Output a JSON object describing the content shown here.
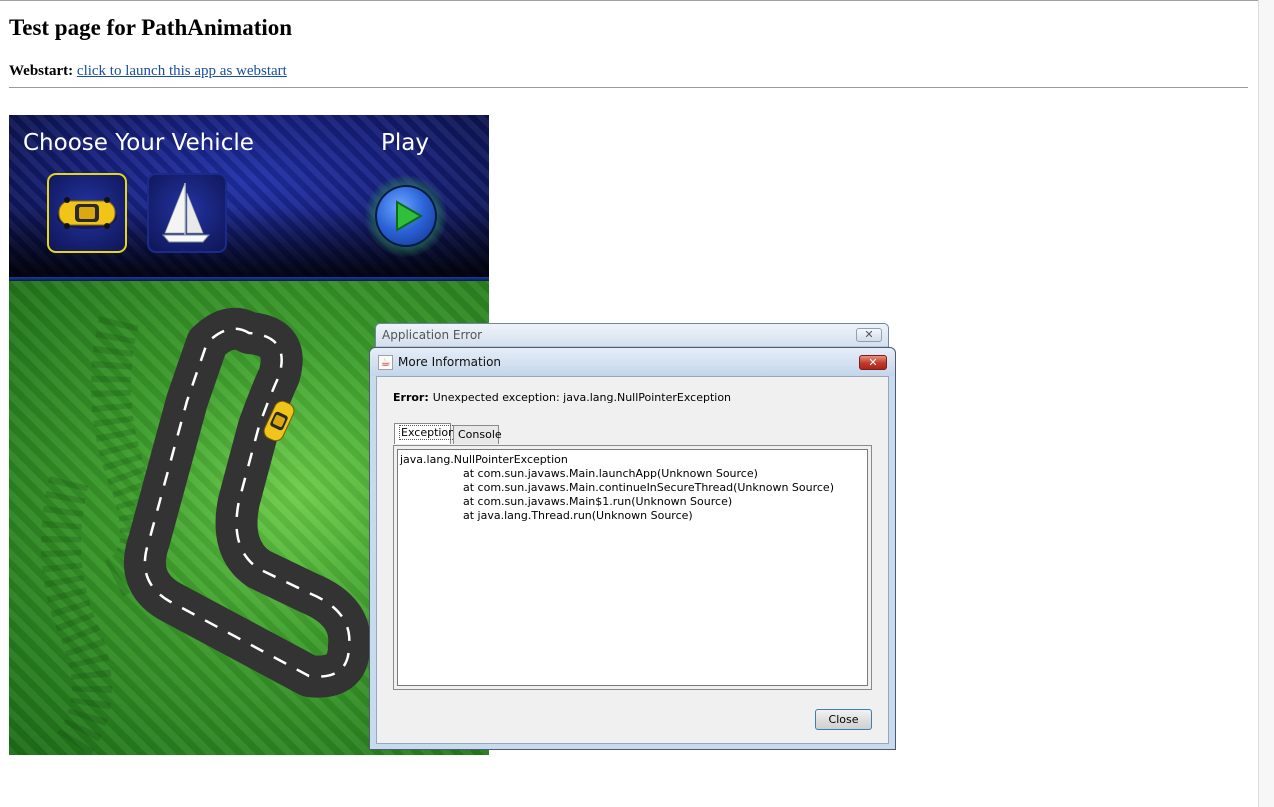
{
  "page": {
    "title": "Test page for PathAnimation",
    "webstart_label": "Webstart:",
    "webstart_link": "click to launch this app as webstart"
  },
  "applet": {
    "choose_label": "Choose Your Vehicle",
    "play_label": "Play",
    "vehicles": [
      {
        "name": "car",
        "selected": true
      },
      {
        "name": "sailboat",
        "selected": false
      }
    ],
    "colors": {
      "top_bg": "#16207e",
      "bottom_bg": "#3d9e2c",
      "selected_border": "#e6d51e",
      "road": "#333333"
    }
  },
  "back_dialog": {
    "title": "Application Error"
  },
  "dialog": {
    "title": "More Information",
    "error_label": "Error:",
    "error_message": "Unexpected exception: java.lang.NullPointerException",
    "tabs": [
      {
        "label": "Exception",
        "active": true
      },
      {
        "label": "Console",
        "active": false
      }
    ],
    "trace": [
      {
        "text": "java.lang.NullPointerException",
        "indent": false
      },
      {
        "text": "at com.sun.javaws.Main.launchApp(Unknown Source)",
        "indent": true
      },
      {
        "text": "at com.sun.javaws.Main.continueInSecureThread(Unknown Source)",
        "indent": true
      },
      {
        "text": "at com.sun.javaws.Main$1.run(Unknown Source)",
        "indent": true
      },
      {
        "text": "at java.lang.Thread.run(Unknown Source)",
        "indent": true
      }
    ],
    "close_label": "Close"
  }
}
